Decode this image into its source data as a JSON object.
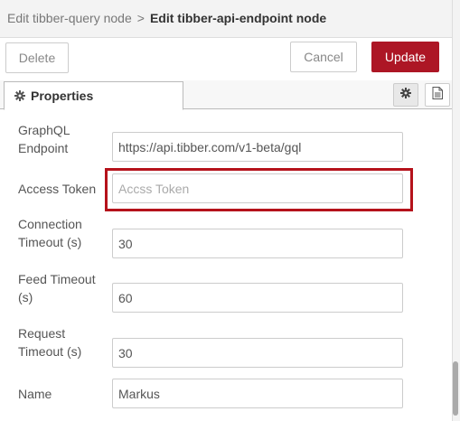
{
  "breadcrumb": {
    "parent": "Edit tibber-query node",
    "separator": ">",
    "current": "Edit tibber-api-endpoint node"
  },
  "toolbar": {
    "delete_label": "Delete",
    "cancel_label": "Cancel",
    "update_label": "Update"
  },
  "tabs": {
    "properties_label": "Properties"
  },
  "colors": {
    "primary": "#ad1625",
    "highlight": "#b5121b"
  },
  "fields": {
    "endpoint": {
      "label_line1": "GraphQL",
      "label_line2": "Endpoint",
      "value": "https://api.tibber.com/v1-beta/gql"
    },
    "access_token": {
      "label": "Access Token",
      "value": "",
      "placeholder": "Accss Token"
    },
    "connection_timeout": {
      "label_line1": "Connection",
      "label_line2": "Timeout (s)",
      "value": "30"
    },
    "feed_timeout": {
      "label_line1": "Feed Timeout",
      "label_line2": "(s)",
      "value": "60"
    },
    "request_timeout": {
      "label_line1": "Request",
      "label_line2": "Timeout (s)",
      "value": "30"
    },
    "name": {
      "label": "Name",
      "value": "Markus"
    }
  },
  "icons": {
    "tab_gear": "gear-icon",
    "settings_gear": "gear-icon",
    "description": "document-icon"
  }
}
